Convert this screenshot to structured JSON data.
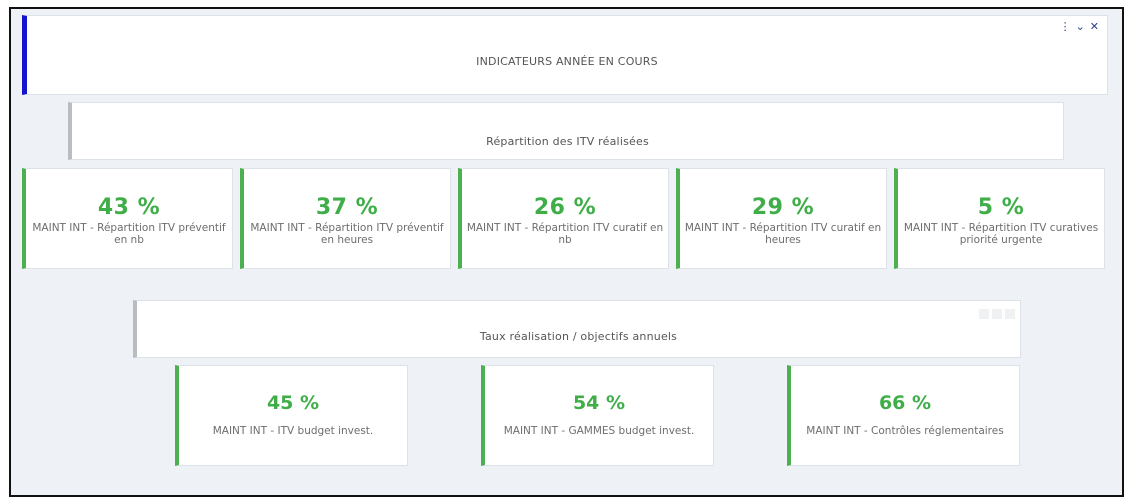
{
  "window": {
    "title": "INDICATEURS ANNÉE EN COURS",
    "controls": [
      "⋮",
      "⌄",
      "✕"
    ]
  },
  "section1": {
    "title": "Répartition des ITV réalisées",
    "kpis": [
      {
        "value": "43 %",
        "label": "MAINT INT - Répartition ITV préventif en nb"
      },
      {
        "value": "37 %",
        "label": "MAINT INT - Répartition ITV préventif en heures"
      },
      {
        "value": "26 %",
        "label": "MAINT INT - Répartition ITV curatif en nb"
      },
      {
        "value": "29 %",
        "label": "MAINT INT - Répartition ITV curatif en heures"
      },
      {
        "value": "5 %",
        "label": "MAINT INT - Répartition ITV curatives priorité urgente"
      }
    ]
  },
  "section2": {
    "title": "Taux réalisation / objectifs annuels",
    "kpis": [
      {
        "value": "45 %",
        "label": "MAINT INT - ITV budget invest."
      },
      {
        "value": "54 %",
        "label": "MAINT INT - GAMMES budget invest."
      },
      {
        "value": "66 %",
        "label": "MAINT INT - Contrôles réglementaires"
      }
    ]
  },
  "colors": {
    "accent_kpi": "#4caf50",
    "value_green": "#3fae49",
    "header_accent": "#1414cc",
    "section_accent": "#b9bcc0"
  }
}
